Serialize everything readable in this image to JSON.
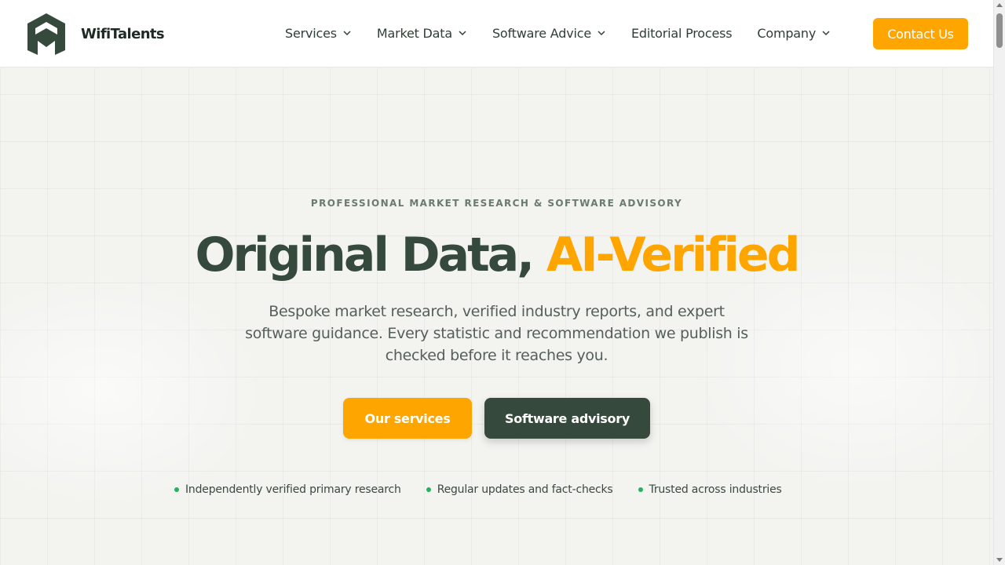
{
  "brand": {
    "name": "WifiTalents",
    "primary_color": "#354a3d",
    "accent_color": "#ffa500"
  },
  "nav": {
    "items": [
      {
        "label": "Services",
        "has_dropdown": true
      },
      {
        "label": "Market Data",
        "has_dropdown": true
      },
      {
        "label": "Software Advice",
        "has_dropdown": true
      },
      {
        "label": "Editorial Process",
        "has_dropdown": false
      },
      {
        "label": "Company",
        "has_dropdown": true
      }
    ],
    "contact_label": "Contact Us"
  },
  "hero": {
    "eyebrow": "PROFESSIONAL MARKET RESEARCH & SOFTWARE ADVISORY",
    "headline_main": "Original Data, ",
    "headline_accent": "AI-Verified",
    "subtitle": "Bespoke market research, verified industry reports, and expert software guidance. Every statistic and recommendation we publish is checked before it reaches you.",
    "primary_cta": "Our services",
    "secondary_cta": "Software advisory",
    "features": [
      "Independently verified primary research",
      "Regular updates and fact-checks",
      "Trusted across industries"
    ],
    "feature_dot_color": "#22b35e"
  }
}
